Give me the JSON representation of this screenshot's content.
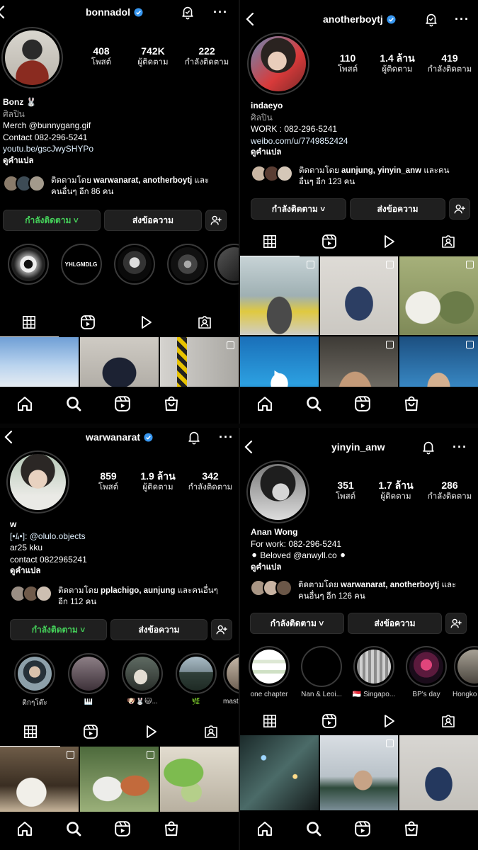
{
  "panels": [
    {
      "username": "bonnadol",
      "stats": [
        {
          "num": "408",
          "label": "โพสต์"
        },
        {
          "num": "742K",
          "label": "ผู้ติดตาม"
        },
        {
          "num": "222",
          "label": "กำลังติดตาม"
        }
      ],
      "bio": {
        "name": "Bonz 🐰",
        "category": "ศิลปิน",
        "lines": [
          "Merch @bunnygang.gif",
          "Contact 082-296-5241"
        ],
        "link": "youtu.be/gscJwySHYPo",
        "translate": "ดูคำแปล"
      },
      "followed_by": {
        "prefix": "ติดตามโดย ",
        "names": "warwanarat, anotherboytj",
        "suffix": " และ",
        "line2": "คนอื่นๆ อีก 86 คน"
      },
      "buttons": {
        "following": "กำลังติดตาม ˅",
        "message": "ส่งข้อความ"
      },
      "highlights": [
        {
          "caption": ""
        },
        {
          "caption": "",
          "text": "YHLGMDLG"
        },
        {
          "caption": ""
        },
        {
          "caption": ""
        },
        {
          "caption": ""
        }
      ]
    },
    {
      "username": "anotherboytj",
      "stats": [
        {
          "num": "110",
          "label": "โพสต์"
        },
        {
          "num": "1.4 ล้าน",
          "label": "ผู้ติดตาม"
        },
        {
          "num": "419",
          "label": "กำลังติดตาม"
        }
      ],
      "bio": {
        "name": "indaeyo",
        "category": "ศิลปิน",
        "lines": [
          "WORK : 082-296-5241"
        ],
        "link": "weibo.com/u/7749852424",
        "translate": "ดูคำแปล"
      },
      "followed_by": {
        "prefix": "ติดตามโดย ",
        "names": "aunjung, yinyin_anw",
        "suffix": " และคน",
        "line2": "อื่นๆ อีก 123 คน"
      },
      "buttons": {
        "following": "กำลังติดตาม ˅",
        "message": "ส่งข้อความ"
      }
    },
    {
      "username": "warwanarat",
      "stats": [
        {
          "num": "859",
          "label": "โพสต์"
        },
        {
          "num": "1.9 ล้าน",
          "label": "ผู้ติดตาม"
        },
        {
          "num": "342",
          "label": "กำลังติดตาม"
        }
      ],
      "bio": {
        "name": "w",
        "category": "",
        "lines": [
          "[•ﾑ•]: @olulo.objects",
          "ar25 kku",
          "contact 0822965241"
        ],
        "link": "",
        "translate": "ดูคำแปล"
      },
      "followed_by": {
        "prefix": "ติดตามโดย ",
        "names": "pplachigo, aunjung",
        "suffix": " และคนอื่นๆ",
        "line2": "อีก 112 คน"
      },
      "buttons": {
        "following": "กำลังติดตาม ˅",
        "message": "ส่งข้อความ"
      },
      "highlights": [
        {
          "caption": "ติกๆโต๊ะ"
        },
        {
          "caption": "🎹"
        },
        {
          "caption": "🐶🐰🐱..."
        },
        {
          "caption": "🌿"
        },
        {
          "caption": "mast"
        }
      ]
    },
    {
      "username": "yinyin_anw",
      "stats": [
        {
          "num": "351",
          "label": "โพสต์"
        },
        {
          "num": "1.7 ล้าน",
          "label": "ผู้ติดตาม"
        },
        {
          "num": "286",
          "label": "กำลังติดตาม"
        }
      ],
      "bio": {
        "name": "Anan Wong",
        "category": "",
        "lines": [
          "For work: 082-296-5241",
          "⚫ Beloved @anwyll.co ⚫"
        ],
        "link": "",
        "translate": "ดูคำแปล"
      },
      "followed_by": {
        "prefix": "ติดตามโดย ",
        "names": "warwanarat, anotherboytj",
        "suffix": " และ",
        "line2": "คนอื่นๆ อีก 126 คน"
      },
      "buttons": {
        "following": "กำลังติดตาม ˅",
        "message": "ส่งข้อความ"
      },
      "highlights": [
        {
          "caption": "one chapter"
        },
        {
          "caption": "Nan & Leoi..."
        },
        {
          "caption": "🇸🇬 Singapo..."
        },
        {
          "caption": "BP's day"
        },
        {
          "caption": "Hongko"
        }
      ]
    }
  ],
  "colors": {
    "following_green": "#45d15a",
    "verified_blue": "#3897f0",
    "background": "#000000"
  }
}
